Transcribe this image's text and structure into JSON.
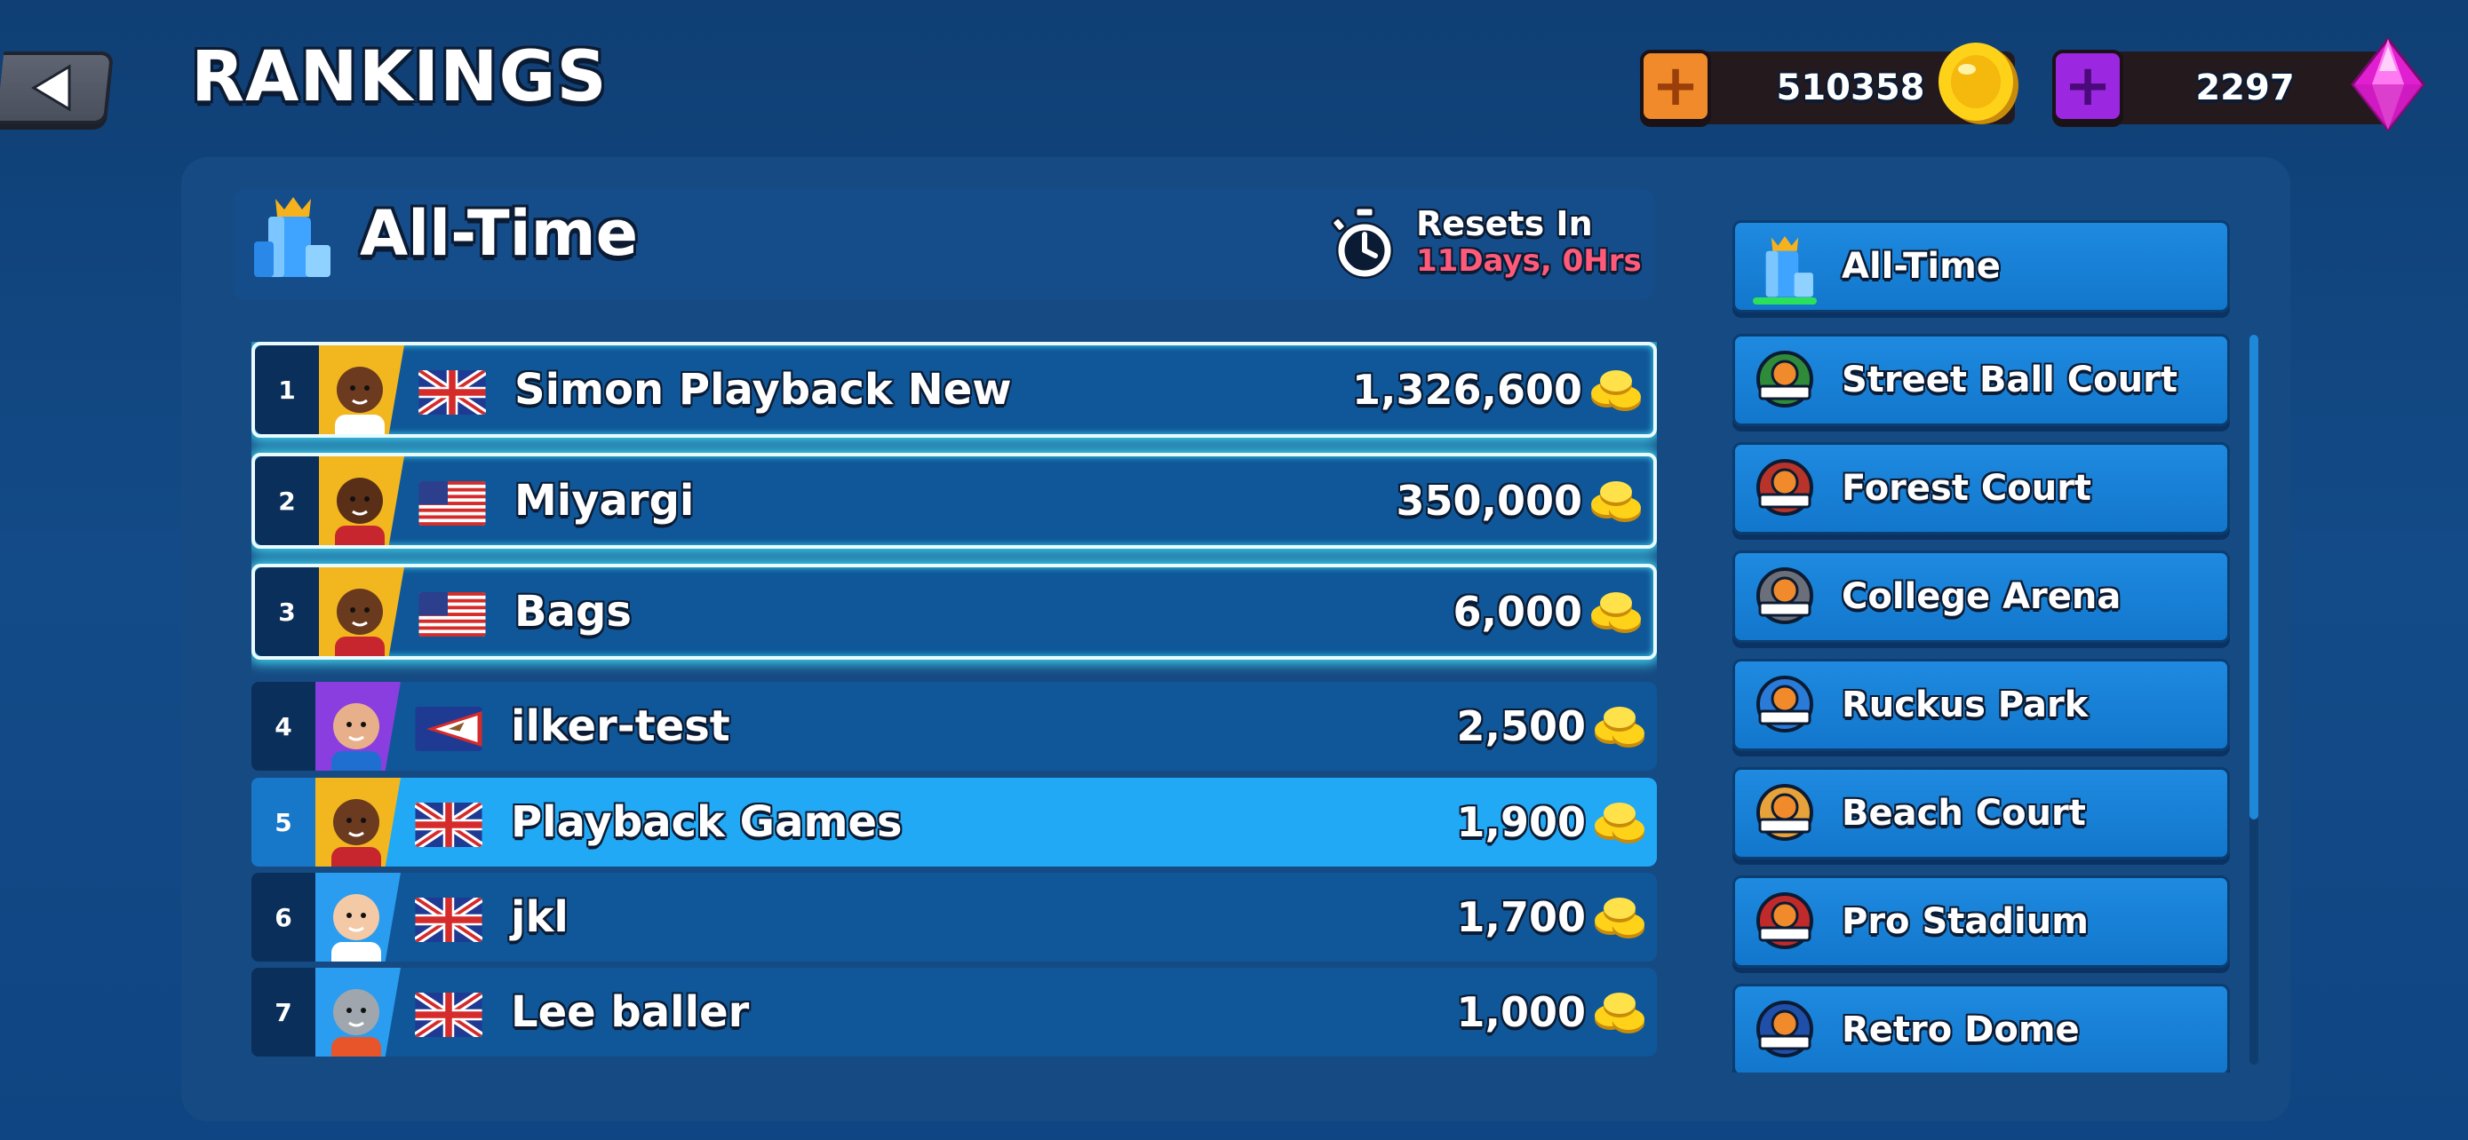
{
  "header": {
    "title": "RANKINGS",
    "back_icon": "back-arrow-icon"
  },
  "currency": {
    "coins": "510358",
    "gems": "2297",
    "coin_plus_color": "#f08a2a",
    "gem_plus_color": "#9b27e0"
  },
  "section": {
    "title": "All-Time",
    "icon": "trophy-icon",
    "resets_label": "Resets In",
    "resets_value": "11Days, 0Hrs"
  },
  "leaderboard": [
    {
      "rank": "1",
      "name": "Simon Playback New",
      "score": "1,326,600",
      "flag": "uk",
      "avatar_color": "#f2b71f",
      "top3": true,
      "self": false
    },
    {
      "rank": "2",
      "name": "Miyargi",
      "score": "350,000",
      "flag": "us",
      "avatar_color": "#f2b71f",
      "top3": true,
      "self": false
    },
    {
      "rank": "3",
      "name": "Bags",
      "score": "6,000",
      "flag": "us",
      "avatar_color": "#f2b71f",
      "top3": true,
      "self": false
    },
    {
      "rank": "4",
      "name": "ilker-test",
      "score": "2,500",
      "flag": "as",
      "avatar_color": "#8a3ee0",
      "top3": false,
      "self": false
    },
    {
      "rank": "5",
      "name": "Playback Games",
      "score": "1,900",
      "flag": "uk",
      "avatar_color": "#f2b71f",
      "top3": false,
      "self": true
    },
    {
      "rank": "6",
      "name": "jkl",
      "score": "1,700",
      "flag": "uk",
      "avatar_color": "#2a9df0",
      "top3": false,
      "self": false
    },
    {
      "rank": "7",
      "name": "Lee baller",
      "score": "1,000",
      "flag": "uk",
      "avatar_color": "#2a9df0",
      "top3": false,
      "self": false
    }
  ],
  "venues": [
    {
      "label": "All-Time",
      "icon": "trophy-icon",
      "selected": true
    },
    {
      "label": "Street Ball Court",
      "icon": "street-ball-court-badge-icon",
      "selected": false
    },
    {
      "label": "Forest Court",
      "icon": "forest-court-badge-icon",
      "selected": false
    },
    {
      "label": "College Arena",
      "icon": "college-arena-badge-icon",
      "selected": false
    },
    {
      "label": "Ruckus Park",
      "icon": "ruckus-park-badge-icon",
      "selected": false
    },
    {
      "label": "Beach Court",
      "icon": "beach-court-badge-icon",
      "selected": false
    },
    {
      "label": "Pro Stadium",
      "icon": "pro-stadium-badge-icon",
      "selected": false
    },
    {
      "label": "Retro Dome",
      "icon": "retro-dome-badge-icon",
      "selected": false
    }
  ]
}
